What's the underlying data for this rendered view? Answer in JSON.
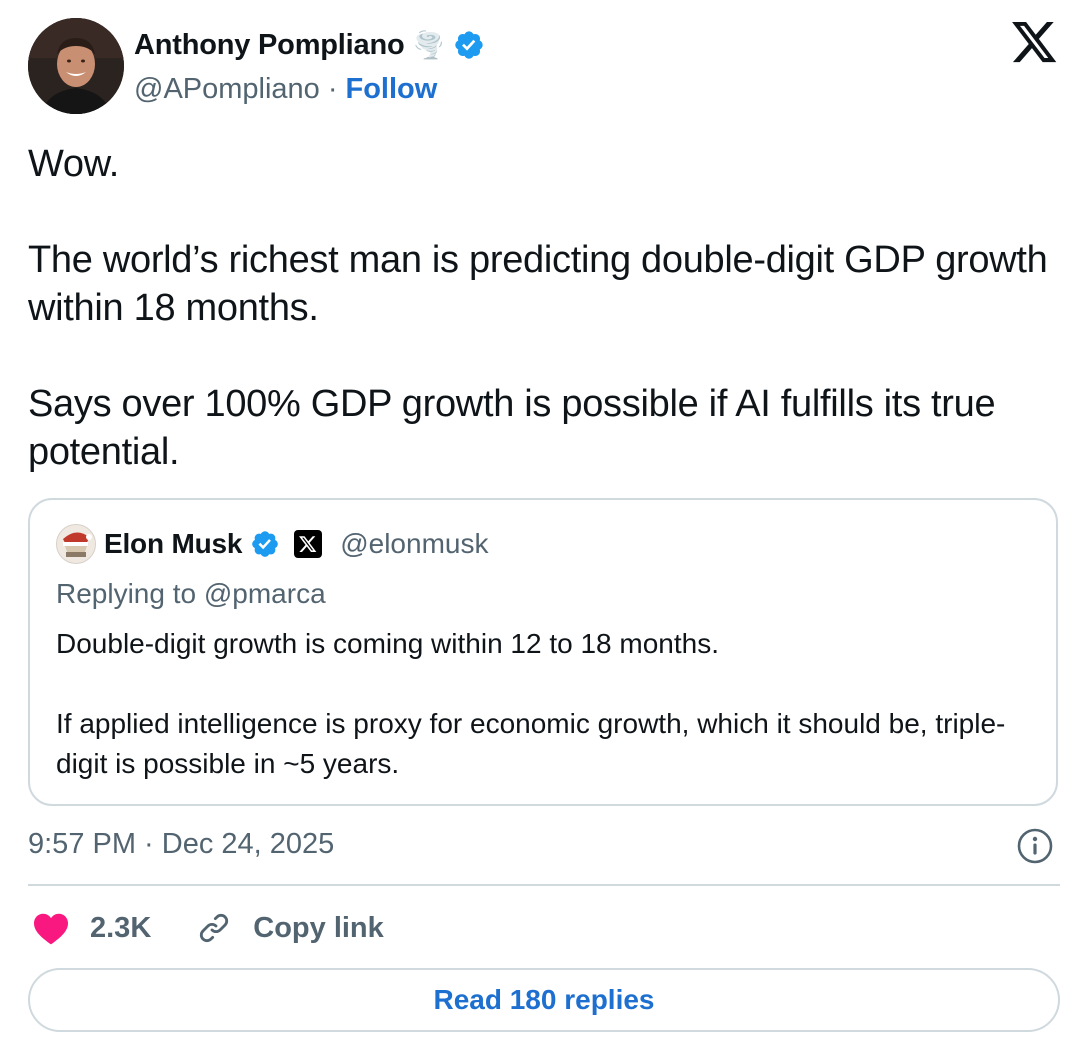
{
  "author": {
    "name": "Anthony Pompliano",
    "emoji": "🌪️",
    "handle": "@APompliano",
    "separator": "·",
    "follow_label": "Follow"
  },
  "tweet": {
    "paragraphs": [
      "Wow.",
      "The world’s richest man is predicting double-digit GDP growth within 18 months.",
      "Says over 100% GDP growth is possible if AI fulfills its true potential."
    ]
  },
  "quoted_tweet": {
    "name": "Elon Musk",
    "handle": "@elonmusk",
    "replying_to": "Replying to @pmarca",
    "paragraphs": [
      "Double-digit growth is coming within 12 to 18 months.",
      "If applied intelligence is proxy for economic growth, which it should be, triple-digit is possible in ~5 years."
    ]
  },
  "timestamp": "9:57 PM · Dec 24, 2025",
  "actions": {
    "likes": "2.3K",
    "copy_link": "Copy link",
    "read_replies": "Read 180 replies"
  },
  "colors": {
    "verified": "#1d9bf0",
    "link": "#1d6fd0",
    "heart": "#f91880",
    "secondary_text": "#536471",
    "border": "#cfd9de"
  },
  "icons": [
    "verified-badge-icon",
    "x-logo-icon",
    "info-icon",
    "heart-icon",
    "link-icon"
  ]
}
